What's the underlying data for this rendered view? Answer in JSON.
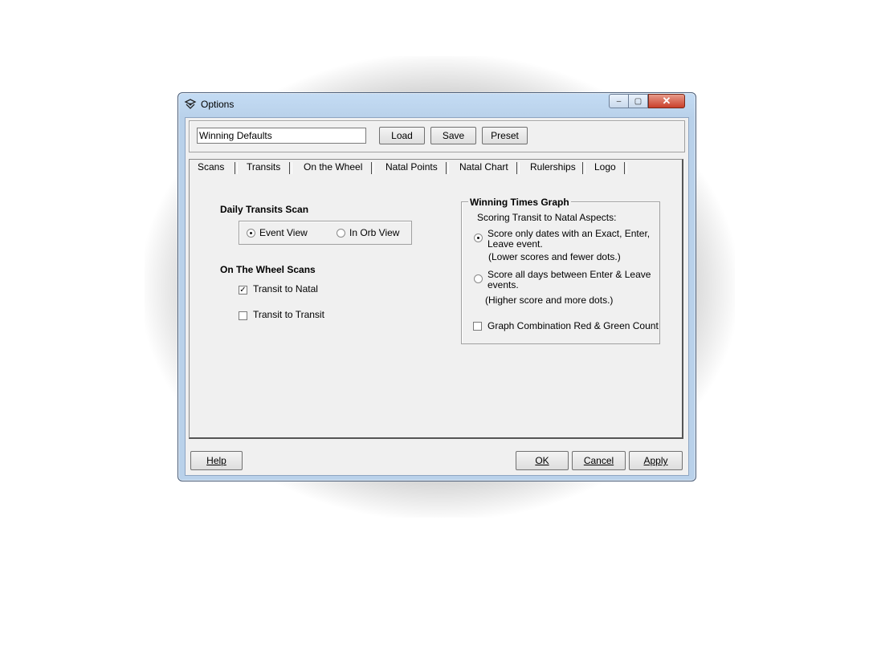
{
  "window": {
    "title": "Options",
    "min_label": "‒",
    "max_label": "▢",
    "close_label": "✕"
  },
  "top": {
    "profile_value": "Winning Defaults",
    "load_label": "Load",
    "save_label": "Save",
    "preset_label": "Preset"
  },
  "tabs": [
    "Scans",
    "Transits",
    "On the Wheel",
    "Natal Points",
    "Natal Chart",
    "Rulerships",
    "Logo"
  ],
  "selected_tab": "Scans",
  "scans": {
    "daily_heading": "Daily Transits Scan",
    "event_view_label": "Event View",
    "orb_view_label": "In Orb View",
    "event_view_selected": true,
    "wheel_heading": "On The Wheel Scans",
    "transit_natal_label": "Transit to Natal",
    "transit_natal_checked": true,
    "transit_transit_label": "Transit to Transit",
    "transit_transit_checked": false
  },
  "winning": {
    "heading": "Winning Times Graph",
    "subtitle": "Scoring Transit to Natal Aspects:",
    "option1_line1": "Score only dates with an Exact, Enter,",
    "option1_line2": "Leave event.",
    "option1_note": "(Lower scores and fewer dots.)",
    "option1_selected": true,
    "option2_line1": "Score  all days between Enter &  Leave",
    "option2_line2": "events.",
    "option2_note": "(Higher score and more dots.)",
    "combo_label": "Graph Combination Red & Green Count",
    "combo_checked": false
  },
  "footer": {
    "help_label": "Help",
    "ok_label": "OK",
    "cancel_label": "Cancel",
    "apply_label": "Apply"
  }
}
